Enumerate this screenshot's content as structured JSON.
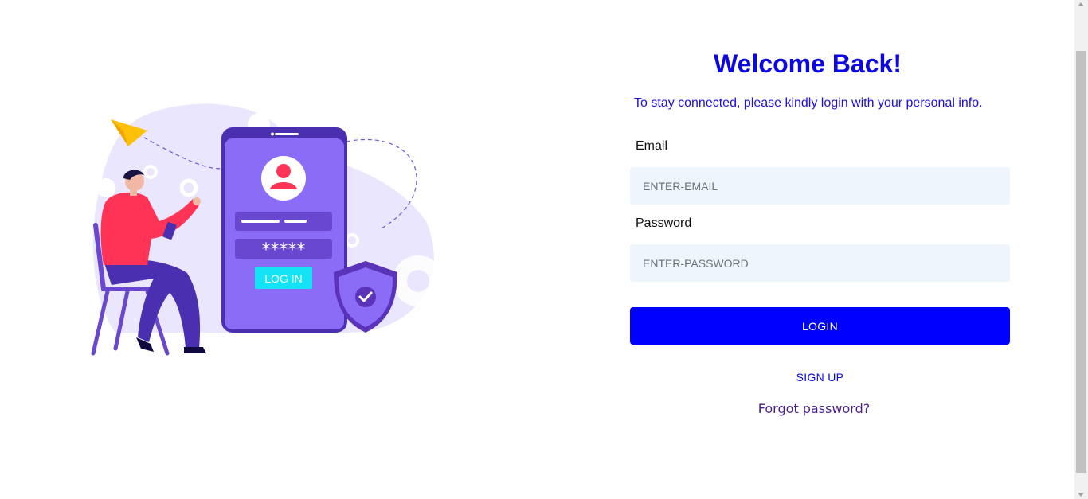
{
  "illustration": {
    "icon": "login-illustration",
    "phone_button_label": "LOG IN",
    "password_mask": "*****"
  },
  "login": {
    "title": "Welcome Back!",
    "subtitle": "To stay connected, please kindly login with your personal info.",
    "email_label": "Email",
    "email_placeholder": "ENTER-EMAIL",
    "email_value": "",
    "password_label": "Password",
    "password_placeholder": "ENTER-PASSWORD",
    "password_value": "",
    "login_button": "LOGIN",
    "signup_link": "SIGN UP",
    "forgot_link": "Forgot password?"
  },
  "colors": {
    "title": "#0b06e2",
    "primary_button": "#0000ff",
    "input_bg": "#eef5fd",
    "illustration_purple": "#8b6cf7",
    "illustration_accent": "#ff3356"
  }
}
